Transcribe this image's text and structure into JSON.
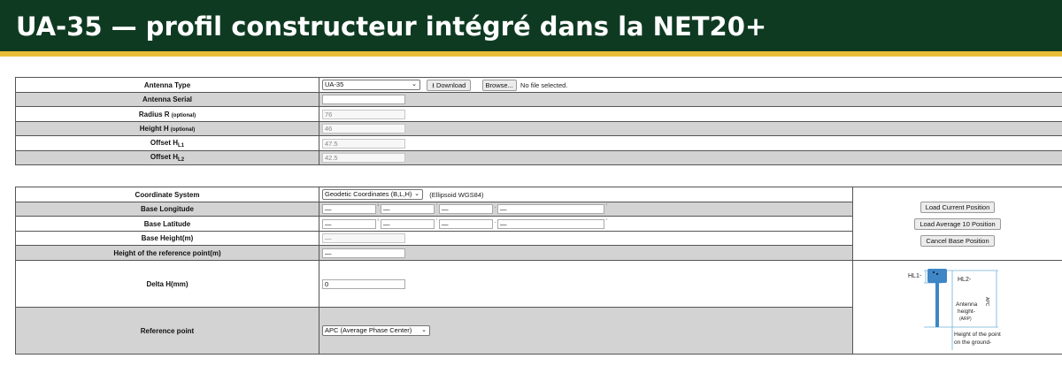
{
  "header": {
    "title": "UA-35 — profil constructeur intégré dans la NET20+"
  },
  "antenna": {
    "type_label": "Antenna Type",
    "type_value": "UA-35",
    "download_label": "Download",
    "browse_label": "Browse...",
    "no_file": "No file selected.",
    "serial_label": "Antenna Serial",
    "serial_value": "",
    "radius_label": "Radius R",
    "radius_optional": "(optional)",
    "radius_value": "76",
    "height_label": "Height H",
    "height_optional": "(optional)",
    "height_value": "46",
    "offset_label": "Offset H",
    "offset_l1_sub": "L1",
    "offset_l1_value": "47.5",
    "offset_l2_sub": "L2",
    "offset_l2_value": "42.5"
  },
  "base": {
    "coord_label": "Coordinate System",
    "coord_value": "Geodetic Coordinates (B,L,H)",
    "ellipsoid": "(Ellipsoid WGS84)",
    "lon_label": "Base Longitude",
    "lat_label": "Base Latitude",
    "placeholder": "—",
    "deg_mark": "°",
    "min_mark": "'",
    "sec_mark": ".",
    "height_label": "Base Height(m)",
    "height_placeholder": "—",
    "ref_height_label": "Height of the reference point(m)",
    "ref_height_value": "—",
    "delta_label": "Delta H(mm)",
    "delta_value": "0",
    "ref_point_label": "Reference point",
    "ref_point_value": "APC (Average Phase Center)",
    "btn_load_current": "Load Current Position",
    "btn_load_average": "Load Average 10 Position",
    "btn_cancel": "Cancel Base Position"
  },
  "diagram": {
    "hl1": "HL1-",
    "hl2": "HL2-",
    "antenna_height_1": "Antenna",
    "antenna_height_2": "height-",
    "antenna_height_3": "(ARP)",
    "apc": "APC",
    "ground_1": "Height of the point",
    "ground_2": "on the ground-"
  }
}
